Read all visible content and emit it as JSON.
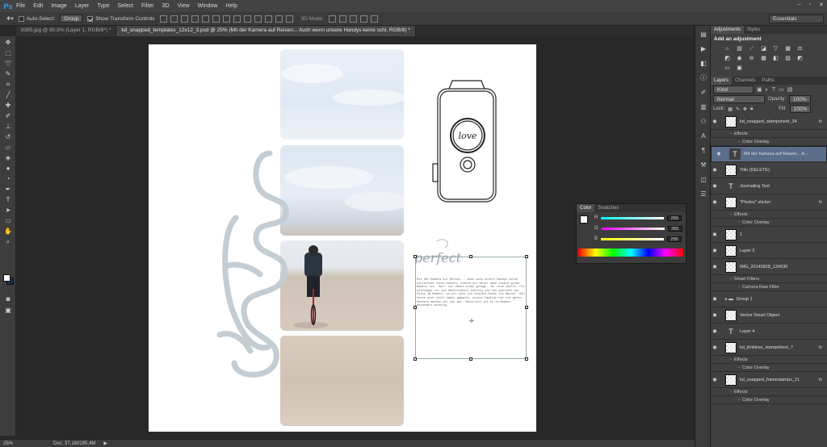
{
  "app": {
    "logo": "Ps"
  },
  "menu": [
    "File",
    "Edit",
    "Image",
    "Layer",
    "Type",
    "Select",
    "Filter",
    "3D",
    "View",
    "Window",
    "Help"
  ],
  "options": {
    "auto_select_label": "Auto-Select:",
    "auto_select_value": "Group",
    "show_transform_label": "Show Transform Controls",
    "mode_3d_label": "3D Mode:",
    "workspace": "Essentials"
  },
  "tabs": [
    {
      "label": "9385.jpg @ 90,9% (Layer 1, RGB/8*) *"
    },
    {
      "label": "kd_snapped_templates_12x12_3.psd @ 25% (Mit der Kamera auf Reisen... Auch wenn unsere Handys keine schl, RGB/8) *"
    }
  ],
  "status": {
    "zoom": "25%",
    "doc": "Doc: 37,1M/185,4M"
  },
  "adjustments": {
    "tabs": [
      "Adjustments",
      "Styles"
    ],
    "title": "Add an adjustment"
  },
  "layers_panel": {
    "tabs": [
      "Layers",
      "Channels",
      "Paths"
    ],
    "kind": "Kind",
    "blend": "Normal",
    "opacity_label": "Opacity:",
    "opacity": "100%",
    "lock_label": "Lock:",
    "fill_label": "Fill:",
    "fill": "100%",
    "rows": [
      {
        "name": "kd_snapped_stampsheet_34",
        "type": "thumb",
        "fx": "fx"
      },
      {
        "name": "Effects",
        "type": "sub"
      },
      {
        "name": "Color Overlay",
        "type": "sub2"
      },
      {
        "name": "Mit der Kamera auf Reisen... A...",
        "type": "text",
        "selected": true
      },
      {
        "name": "Title (DELETE)",
        "type": "thumb"
      },
      {
        "name": "Journaling Text",
        "type": "text"
      },
      {
        "name": "\"Photos\" sticker",
        "type": "thumb",
        "fx": "fx"
      },
      {
        "name": "Effects",
        "type": "sub"
      },
      {
        "name": "Color Overlay",
        "type": "sub2"
      },
      {
        "name": "1",
        "type": "thumb"
      },
      {
        "name": "Layer 3",
        "type": "thumb"
      },
      {
        "name": "IMG_20140828_134936",
        "type": "thumb"
      },
      {
        "name": "Smart Filters",
        "type": "sub"
      },
      {
        "name": "Camera Raw Filter",
        "type": "sub2"
      },
      {
        "name": "Group 1",
        "type": "group"
      },
      {
        "name": "Vector Smart Object",
        "type": "thumb"
      },
      {
        "name": "Layer 4",
        "type": "text"
      },
      {
        "name": "kd_limitless_stampsheet_7",
        "type": "thumb",
        "fx": "fx"
      },
      {
        "name": "Effects",
        "type": "sub"
      },
      {
        "name": "Color Overlay",
        "type": "sub2"
      },
      {
        "name": "kd_snapped_framestamps_21",
        "type": "thumb",
        "fx": "fx"
      },
      {
        "name": "Effects",
        "type": "sub"
      },
      {
        "name": "Color Overlay",
        "type": "sub2"
      }
    ]
  },
  "color_panel": {
    "tabs": [
      "Color",
      "Swatches"
    ],
    "r_label": "R",
    "g_label": "G",
    "b_label": "B",
    "r": "255",
    "g": "255",
    "b": "255"
  },
  "canvas": {
    "stamp_word": "perfect",
    "sticker_word": "photos",
    "love_word": "love",
    "journal": "Mit der Kamera auf Reisen... Auch wenn unsere Handys keine schlechten Fotos machen, ziehen wir meist doch unsere große Kamera los. \"Wir\" ist dabei schön gesagt. Ja, eine zweite. Für unterwegs ist die Handlichkeit wichtig und die Qualität der Fotos im Moment, wo wir eins ins schiefe Handy ins Wasser. Bin heute noch nicht damit gemacht, unsere Familie hat sie gerne. Deshalb machen wir nun mal. Natürlich ist es im Moment besonders wichtig."
  },
  "colors": {
    "accent": "#2fa3f6",
    "selected_layer": "#5a6e8c",
    "sticker": "#c3cdd3",
    "fg_swatch": "#ffffff",
    "bg_swatch": "#1b2d52"
  }
}
